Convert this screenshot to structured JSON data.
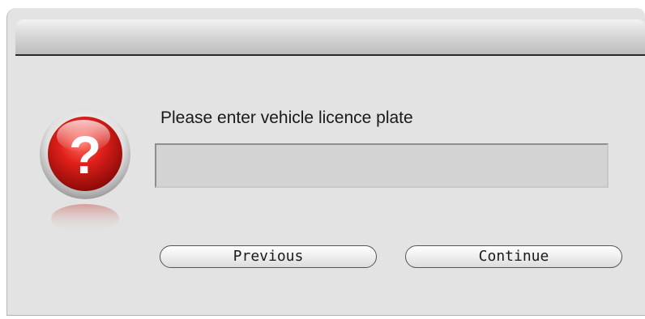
{
  "dialog": {
    "prompt": "Please enter vehicle licence plate",
    "plate_input_value": "",
    "icon": "question-mark-icon"
  },
  "buttons": {
    "previous_label": "Previous",
    "continue_label": "Continue"
  },
  "colors": {
    "icon_red": "#d41a1a",
    "dialog_bg": "#e3e3e3",
    "input_bg": "#d3d3d3"
  }
}
